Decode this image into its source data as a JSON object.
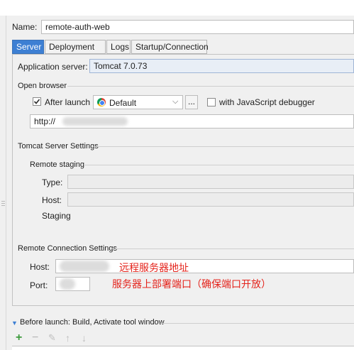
{
  "form": {
    "name_label": "Name:",
    "name_value": "remote-auth-web"
  },
  "tabs": [
    "Server",
    "Deployment",
    "Logs",
    "Startup/Connection"
  ],
  "server": {
    "app_server_label": "Application server:",
    "app_server_value": "Tomcat 7.0.73",
    "open_browser_title": "Open browser",
    "after_launch_label": "After launch",
    "after_launch_checked": true,
    "browser_value": "Default",
    "more_button": "...",
    "js_debugger_label": "with JavaScript debugger",
    "js_debugger_checked": false,
    "url_prefix": "http://"
  },
  "tomcat_settings": {
    "title": "Tomcat Server Settings",
    "remote_staging": "Remote staging",
    "type_label": "Type:",
    "host_label": "Host:",
    "staging_label": "Staging"
  },
  "remote_connection": {
    "title": "Remote Connection Settings",
    "host_label": "Host:",
    "port_label": "Port:",
    "host_note": "远程服务器地址",
    "port_note": "服务器上部署端口（确保端口开放）"
  },
  "before_launch": {
    "label": "Before launch: Build, Activate tool window"
  },
  "toolbar": {
    "add": "+",
    "remove": "−",
    "edit": "✎",
    "up": "↑",
    "down": "↓"
  },
  "colors": {
    "active_tab": "#3d7fd3",
    "note_red": "#e4231b",
    "add_green": "#3c9a3c"
  }
}
